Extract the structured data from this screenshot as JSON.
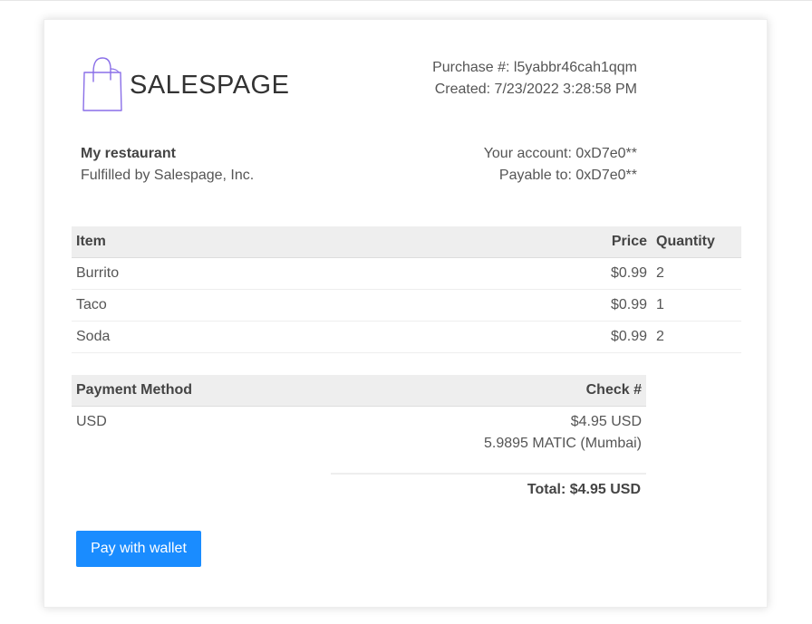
{
  "brand": {
    "name": "SALESPAGE",
    "logo_icon": "shopping-bag-icon",
    "accent_color": "#8a6fe8"
  },
  "purchase": {
    "number_line": "Purchase #: l5yabbr46cah1qqm",
    "created_line": "Created: 7/23/2022 3:28:58 PM"
  },
  "merchant": {
    "name": "My restaurant",
    "fulfilled_by": "Fulfilled by Salespage, Inc."
  },
  "account": {
    "your_account": "Your account: 0xD7e0**",
    "payable_to": "Payable to: 0xD7e0**"
  },
  "items_table": {
    "headers": {
      "item": "Item",
      "price": "Price",
      "quantity": "Quantity"
    },
    "rows": [
      {
        "item": "Burrito",
        "price": "$0.99",
        "quantity": "2"
      },
      {
        "item": "Taco",
        "price": "$0.99",
        "quantity": "1"
      },
      {
        "item": "Soda",
        "price": "$0.99",
        "quantity": "2"
      }
    ]
  },
  "payment_table": {
    "headers": {
      "method": "Payment Method",
      "check": "Check #"
    },
    "method": "USD",
    "amount_usd": "$4.95 USD",
    "amount_matic": "5.9895 MATIC (Mumbai)"
  },
  "total": "Total: $4.95 USD",
  "pay_button": {
    "label": "Pay with wallet",
    "color": "#1a8cff"
  }
}
